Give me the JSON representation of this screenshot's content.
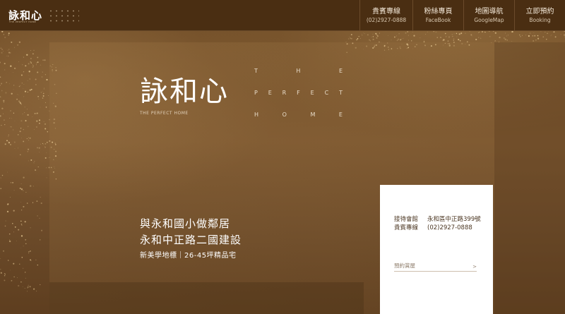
{
  "header": {
    "logo": "詠和心",
    "logo_sub": "THE PERFECT HOME",
    "nav": [
      {
        "label": "貴賓專線",
        "sub": "(02)2927-0888"
      },
      {
        "label": "粉絲專頁",
        "sub": "FaceBook"
      },
      {
        "label": "地圖導航",
        "sub": "GoogleMap"
      },
      {
        "label": "立即預約",
        "sub": "Booking"
      }
    ]
  },
  "hero": {
    "title": "詠和心",
    "subtitle": "THE PERFECT HOME",
    "tagline_rows": [
      [
        "T",
        "H",
        "E"
      ],
      [
        "P",
        "E",
        "R",
        "F",
        "E",
        "C",
        "T"
      ],
      [
        "H",
        "O",
        "M",
        "E"
      ]
    ],
    "line1": "與永和國小做鄰居",
    "line2": "永和中正路二國建設",
    "line3": "新美學地標｜26-45坪精品宅"
  },
  "card": {
    "address_label": "接待會館",
    "address_value": "永和區中正路399號",
    "phone_label": "貴賓專線",
    "phone_value": "(02)2927-0888",
    "field_placeholder": "預約賞屋",
    "field_icon": "chevron-right-icon"
  },
  "colors": {
    "header_bg": "#4a2e12",
    "page_bg": "#7c5730",
    "card_bg": "#ffffff",
    "accent_gold": "#d8b87a"
  }
}
